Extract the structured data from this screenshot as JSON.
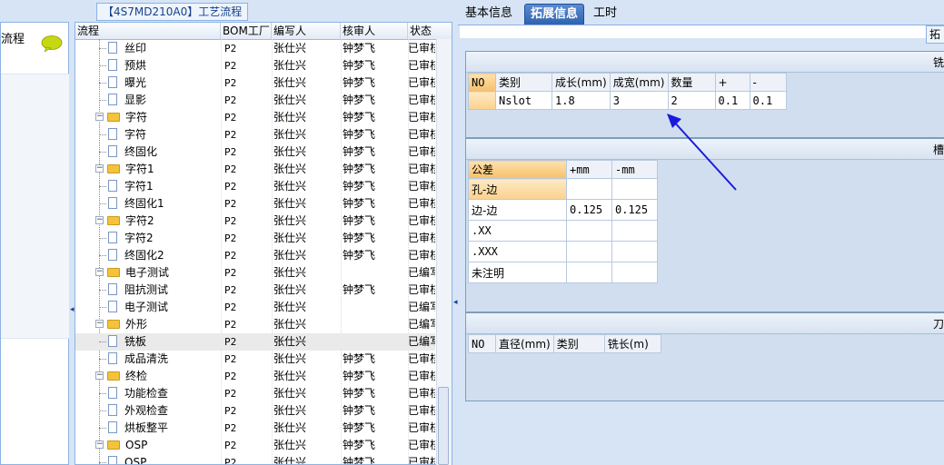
{
  "left_panel": {
    "title": "流程"
  },
  "tree": {
    "title": "【4S7MD210A0】工艺流程",
    "columns": {
      "process": "流程",
      "bom": "BOM工厂",
      "writer": "编写人",
      "reviewer": "核审人",
      "status": "状态"
    },
    "rows": [
      {
        "type": "doc",
        "indent": 1,
        "name": "丝印",
        "bom": "P2",
        "writer": "张仕兴",
        "reviewer": "钟梦飞",
        "status": "已审核"
      },
      {
        "type": "doc",
        "indent": 1,
        "name": "预烘",
        "bom": "P2",
        "writer": "张仕兴",
        "reviewer": "钟梦飞",
        "status": "已审核"
      },
      {
        "type": "doc",
        "indent": 1,
        "name": "曝光",
        "bom": "P2",
        "writer": "张仕兴",
        "reviewer": "钟梦飞",
        "status": "已审核"
      },
      {
        "type": "doc",
        "indent": 1,
        "name": "显影",
        "bom": "P2",
        "writer": "张仕兴",
        "reviewer": "钟梦飞",
        "status": "已审核"
      },
      {
        "type": "folder",
        "indent": 0,
        "name": "字符",
        "bom": "P2",
        "writer": "张仕兴",
        "reviewer": "钟梦飞",
        "status": "已审核"
      },
      {
        "type": "doc",
        "indent": 1,
        "name": "字符",
        "bom": "P2",
        "writer": "张仕兴",
        "reviewer": "钟梦飞",
        "status": "已审核"
      },
      {
        "type": "doc",
        "indent": 1,
        "name": "终固化",
        "bom": "P2",
        "writer": "张仕兴",
        "reviewer": "钟梦飞",
        "status": "已审核"
      },
      {
        "type": "folder",
        "indent": 0,
        "name": "字符1",
        "bom": "P2",
        "writer": "张仕兴",
        "reviewer": "钟梦飞",
        "status": "已审核"
      },
      {
        "type": "doc",
        "indent": 1,
        "name": "字符1",
        "bom": "P2",
        "writer": "张仕兴",
        "reviewer": "钟梦飞",
        "status": "已审核"
      },
      {
        "type": "doc",
        "indent": 1,
        "name": "终固化1",
        "bom": "P2",
        "writer": "张仕兴",
        "reviewer": "钟梦飞",
        "status": "已审核"
      },
      {
        "type": "folder",
        "indent": 0,
        "name": "字符2",
        "bom": "P2",
        "writer": "张仕兴",
        "reviewer": "钟梦飞",
        "status": "已审核"
      },
      {
        "type": "doc",
        "indent": 1,
        "name": "字符2",
        "bom": "P2",
        "writer": "张仕兴",
        "reviewer": "钟梦飞",
        "status": "已审核"
      },
      {
        "type": "doc",
        "indent": 1,
        "name": "终固化2",
        "bom": "P2",
        "writer": "张仕兴",
        "reviewer": "钟梦飞",
        "status": "已审核"
      },
      {
        "type": "folder",
        "indent": 0,
        "name": "电子测试",
        "bom": "P2",
        "writer": "张仕兴",
        "reviewer": "",
        "status": "已编写"
      },
      {
        "type": "doc",
        "indent": 1,
        "name": "阻抗测试",
        "bom": "P2",
        "writer": "张仕兴",
        "reviewer": "钟梦飞",
        "status": "已审核"
      },
      {
        "type": "doc",
        "indent": 1,
        "name": "电子测试",
        "bom": "P2",
        "writer": "张仕兴",
        "reviewer": "",
        "status": "已编写"
      },
      {
        "type": "folder",
        "indent": 0,
        "name": "外形",
        "bom": "P2",
        "writer": "张仕兴",
        "reviewer": "",
        "status": "已编写"
      },
      {
        "type": "doc",
        "indent": 1,
        "name": "铣板",
        "bom": "P2",
        "writer": "张仕兴",
        "reviewer": "",
        "status": "已编写",
        "selected": true
      },
      {
        "type": "doc",
        "indent": 1,
        "name": "成品清洗",
        "bom": "P2",
        "writer": "张仕兴",
        "reviewer": "钟梦飞",
        "status": "已审核"
      },
      {
        "type": "folder",
        "indent": 0,
        "name": "终检",
        "bom": "P2",
        "writer": "张仕兴",
        "reviewer": "钟梦飞",
        "status": "已审核"
      },
      {
        "type": "doc",
        "indent": 1,
        "name": "功能检查",
        "bom": "P2",
        "writer": "张仕兴",
        "reviewer": "钟梦飞",
        "status": "已审核"
      },
      {
        "type": "doc",
        "indent": 1,
        "name": "外观检查",
        "bom": "P2",
        "writer": "张仕兴",
        "reviewer": "钟梦飞",
        "status": "已审核"
      },
      {
        "type": "doc",
        "indent": 1,
        "name": "烘板整平",
        "bom": "P2",
        "writer": "张仕兴",
        "reviewer": "钟梦飞",
        "status": "已审核"
      },
      {
        "type": "folder",
        "indent": 0,
        "name": "OSP",
        "bom": "P2",
        "writer": "张仕兴",
        "reviewer": "钟梦飞",
        "status": "已审核"
      },
      {
        "type": "doc",
        "indent": 1,
        "name": "OSP",
        "bom": "P2",
        "writer": "张仕兴",
        "reviewer": "钟梦飞",
        "status": "已审核"
      }
    ]
  },
  "tabs": [
    "基本信息",
    "拓展信息",
    "工时"
  ],
  "active_tab": "拓展信息",
  "toolbar": {
    "extend_label": "拓"
  },
  "section_mill": {
    "title": "铣",
    "headers": [
      "NO",
      "类别",
      "成长(mm)",
      "成宽(mm)",
      "数量",
      "+",
      "-"
    ],
    "rows": [
      [
        "",
        "Nslot",
        "1.8",
        "3",
        "2",
        "0.1",
        "0.1"
      ]
    ]
  },
  "section_slot": {
    "title": "槽",
    "headers": [
      "公差",
      "+mm",
      "-mm"
    ],
    "rows": [
      [
        "孔-边",
        "",
        ""
      ],
      [
        "边-边",
        "0.125",
        "0.125"
      ],
      [
        ".XX",
        "",
        ""
      ],
      [
        ".XXX",
        "",
        ""
      ],
      [
        "未注明",
        "",
        ""
      ]
    ]
  },
  "section_hole": {
    "title": "刀",
    "headers": [
      "NO",
      "直径(mm)",
      "类别",
      "铣长(m)"
    ]
  },
  "colors": {
    "accent": "#2f62b0",
    "arrow": "#1a1adb",
    "header_orange": "#f8c06a"
  }
}
